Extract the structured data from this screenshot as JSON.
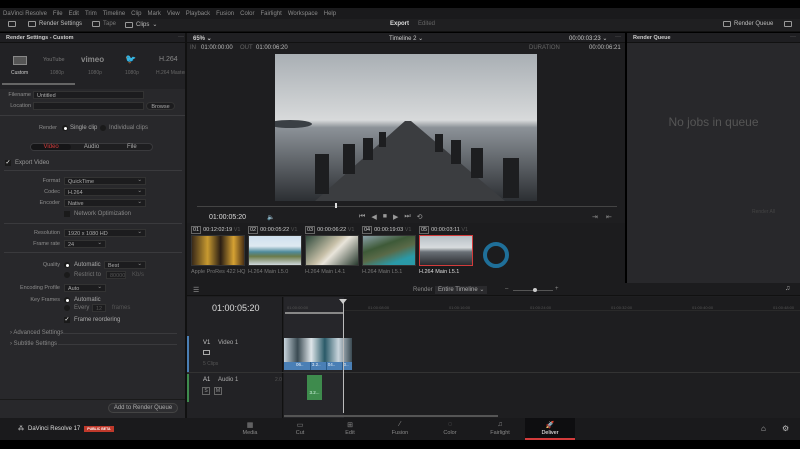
{
  "menu": [
    "DaVinci Resolve",
    "File",
    "Edit",
    "Trim",
    "Timeline",
    "Clip",
    "Mark",
    "View",
    "Playback",
    "Fusion",
    "Color",
    "Fairlight",
    "Workspace",
    "Help"
  ],
  "toolbar": {
    "render_settings": "Render Settings",
    "tape": "Tape",
    "clips": "Clips",
    "title": "Export",
    "status": "Edited",
    "render_queue": "Render Queue"
  },
  "left": {
    "header": "Render Settings - Custom",
    "presets": [
      {
        "name": "Custom",
        "sub": "Custom"
      },
      {
        "name": "YouTube",
        "sub": "1080p"
      },
      {
        "name": "vimeo",
        "sub": "1080p"
      },
      {
        "name": "Twitter",
        "sub": "1080p"
      },
      {
        "name": "H.264",
        "sub": "H.264 Master"
      }
    ],
    "filename_label": "Filename",
    "filename": "Untitled",
    "location_label": "Location",
    "location": "",
    "browse": "Browse",
    "render_label": "Render",
    "single_clip": "Single clip",
    "individual_clips": "Individual clips",
    "tabs": [
      "Video",
      "Audio",
      "File"
    ],
    "export_video": "Export Video",
    "format_label": "Format",
    "format": "QuickTime",
    "codec_label": "Codec",
    "codec": "H.264",
    "encoder_label": "Encoder",
    "encoder": "Native",
    "network_opt": "Network Optimization",
    "resolution_label": "Resolution",
    "resolution": "1920 x 1080 HD",
    "framerate_label": "Frame rate",
    "framerate": "24",
    "quality_label": "Quality",
    "quality_auto": "Automatic",
    "quality": "Best",
    "restrict": "Restrict to",
    "restrict_val": "80000",
    "restrict_unit": "Kb/s",
    "profile_label": "Encoding Profile",
    "profile": "Auto",
    "keyframes_label": "Key Frames",
    "kf_auto": "Automatic",
    "kf_every": "Every",
    "kf_val": "12",
    "kf_unit": "frames",
    "frame_reorder": "Frame reordering",
    "advanced": "Advanced Settings",
    "subtitle": "Subtitle Settings",
    "add_queue": "Add to Render Queue"
  },
  "viewer": {
    "zoom": "65%",
    "timeline": "Timeline 2",
    "tc_top": "00:00:03:23",
    "in_label": "IN",
    "in": "01:00:00:00",
    "out_label": "OUT",
    "out": "01:00:06:20",
    "duration_label": "DURATION",
    "duration": "00:00:06:21",
    "timecode": "01:00:05:20"
  },
  "render_queue": {
    "header": "Render Queue",
    "empty": "No jobs in queue",
    "render_all": "Render All"
  },
  "clips": [
    {
      "num": "01",
      "tc": "00:12:02:19",
      "track": "V1",
      "codec": "Apple ProRes 422 HQ"
    },
    {
      "num": "02",
      "tc": "00:00:05:22",
      "track": "V1",
      "codec": "H.264 Main L5.0"
    },
    {
      "num": "03",
      "tc": "00:00:06:22",
      "track": "V1",
      "codec": "H.264 Main L4.1"
    },
    {
      "num": "04",
      "tc": "00:00:19:03",
      "track": "V1",
      "codec": "H.264 Main L5.1"
    },
    {
      "num": "05",
      "tc": "00:00:03:11",
      "track": "V1",
      "codec": "H.264 Main L5.1"
    }
  ],
  "timeline": {
    "render_label": "Render",
    "render_mode": "Entire Timeline",
    "timecode": "01:00:05:20",
    "ruler": [
      "01:00:00:00",
      "01:00:08:00",
      "01:00:16:00",
      "01:00:24:00",
      "01:00:32:00",
      "01:00:40:00",
      "01:00:48:00"
    ],
    "v1": "V1",
    "v1_name": "Video 1",
    "v1_clips": "5 Clips",
    "a1": "A1",
    "a1_name": "Audio 1",
    "a1_ch": "2.0",
    "solo": "S",
    "mute": "M",
    "vclip_labels": [
      "06..",
      "3.2..",
      "04..",
      "0.."
    ],
    "aclip_label": "3.2..."
  },
  "pages": [
    "Media",
    "Cut",
    "Edit",
    "Fusion",
    "Color",
    "Fairlight",
    "Deliver"
  ],
  "brand": {
    "name": "DaVinci Resolve 17",
    "badge": "PUBLIC BETA"
  },
  "colors": {
    "accent": "#d23b3b",
    "track_video": "#4a7fb5",
    "track_audio": "#3e8b4d",
    "loading": "#1f6f99"
  }
}
